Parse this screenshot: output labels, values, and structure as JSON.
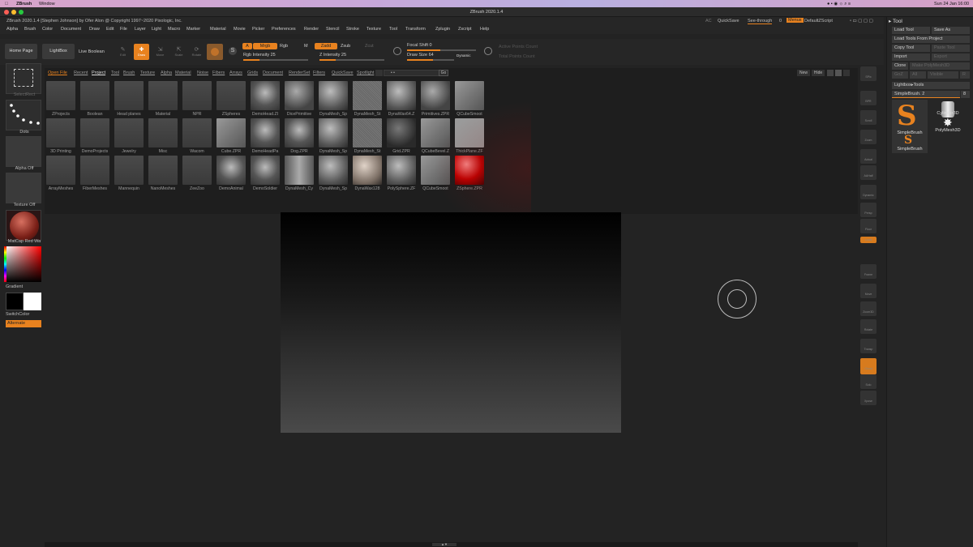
{
  "macos": {
    "app": "ZBrush",
    "menu": "Window",
    "clock": "Sun 24 Jan 16:00"
  },
  "window_title": "ZBrush 2020.1.4",
  "info": {
    "left": "ZBrush 2020.1.4 [Stephen Johnson] by Ofer Alon @ Copyright 1997~2020 Pixologic, Inc.",
    "ac": "AC",
    "quicksave": "QuickSave",
    "seethrough": "See-through",
    "seethrough_val": "0",
    "menus": "Menus",
    "script": "DefaultZScript"
  },
  "menus": [
    "Alpha",
    "Brush",
    "Color",
    "Document",
    "Draw",
    "Edit",
    "File",
    "Layer",
    "Light",
    "Macro",
    "Marker",
    "Material",
    "Movie",
    "Picker",
    "Preferences",
    "Render",
    "Stencil",
    "Stroke",
    "Texture",
    "Tool",
    "Transform",
    "Zplugin",
    "Zscript",
    "Help"
  ],
  "shelf": {
    "home": "Home Page",
    "lightbox": "LightBox",
    "live_boolean": "Live Boolean",
    "edit": "Edit",
    "draw": "Draw",
    "move": "Move",
    "scale": "Scale",
    "rotate": "Rotate",
    "a": "A",
    "mrgb": "Mrgb",
    "rgb": "Rgb",
    "m": "M",
    "zadd": "Zadd",
    "zsub": "Zsub",
    "zcut": "Zcut",
    "rgb_intensity": "Rgb Intensity 25",
    "z_intensity": "Z Intensity 25",
    "focal_shift": "Focal Shift 0",
    "draw_size": "Draw Size 64",
    "dynamic": "Dynamic",
    "active_points": "Active Points Count",
    "total_points": "Total Points Count",
    "rgb_intensity_level": 0.25,
    "z_intensity_level": 0.25,
    "draw_size_level": 0.55
  },
  "left": {
    "selectrect": "SelectRect",
    "dots": "Dots",
    "alpha": "Alpha Off",
    "texture": "Texture Off",
    "matcap": "MatCap Red Wa",
    "gradient": "Gradient",
    "switchcolor": "SwitchColor",
    "alternate": "Alternate"
  },
  "lightbox_tabs": [
    "Open File",
    "Recent",
    "Project",
    "Tool",
    "Brush",
    "Texture",
    "Alpha",
    "Material",
    "Noise",
    "Fibers",
    "Arrays",
    "Grids",
    "Document",
    "RenderSet",
    "Filters",
    "QuickSave",
    "Spotlight"
  ],
  "lightbox_controls": {
    "go": "Go",
    "new": "New",
    "hide": "Hide"
  },
  "tiles_row1": [
    "ZProjects",
    "Boolean",
    "Head planes",
    "Material",
    "NPR",
    "ZSpheres",
    "DemoHead.ZI",
    "DicePrimitive",
    "DynaMesh_Sp",
    "DynaMesh_St",
    "DynaWax64.Z",
    "Primitives.ZPR",
    "QCubeSmoot"
  ],
  "tiles_row2": [
    "3D Printing",
    "DemoProjects",
    "Jewelry",
    "Misc",
    "Wacom",
    "Cube.ZPR",
    "DemoHeadPa",
    "Dog.ZPR",
    "DynaMesh_Sp",
    "DynaMesh_St",
    "Grid.ZPR",
    "QCubeBevel.Z",
    "ThickPlane.ZF"
  ],
  "tiles_row3": [
    "ArrayMeshes",
    "FiberMeshes",
    "Mannequin",
    "NanoMeshes",
    "ZeeZoo",
    "DemoAnimal",
    "DemoSoldier",
    "DynaMesh_Cy",
    "DynaMesh_Sp",
    "DynaWax128",
    "PolySphere.ZF",
    "QCubeSmoot",
    "ZSphere.ZPR"
  ],
  "right_shelf": [
    "SPix",
    "BPR",
    "Scroll",
    "Zoom",
    "Actual",
    "AAHalf",
    "Dynamic",
    "Persp",
    "Floor",
    "Local",
    "Frame",
    "Move",
    "Zoom3D",
    "Rotate",
    "Transp",
    "Ghost",
    "Solo",
    "Xpose"
  ],
  "tool": {
    "title": "Tool",
    "load": "Load Tool",
    "save_as": "Save As",
    "load_project": "Load Tools From Project",
    "copy": "Copy Tool",
    "paste": "Paste Tool",
    "import": "Import",
    "export": "Export",
    "clone": "Clone",
    "make_polymesh": "Make PolyMesh3D",
    "goz": "GoZ",
    "all": "All",
    "visible": "Visible",
    "r": "R",
    "lightbox_tools": "Lightbox▸Tools",
    "current": "SimpleBrush. 2",
    "current_num": "8",
    "thumbs": [
      "SimpleBrush",
      "Cylinder3D",
      "PolyMesh3D",
      "SimpleBrush"
    ]
  }
}
